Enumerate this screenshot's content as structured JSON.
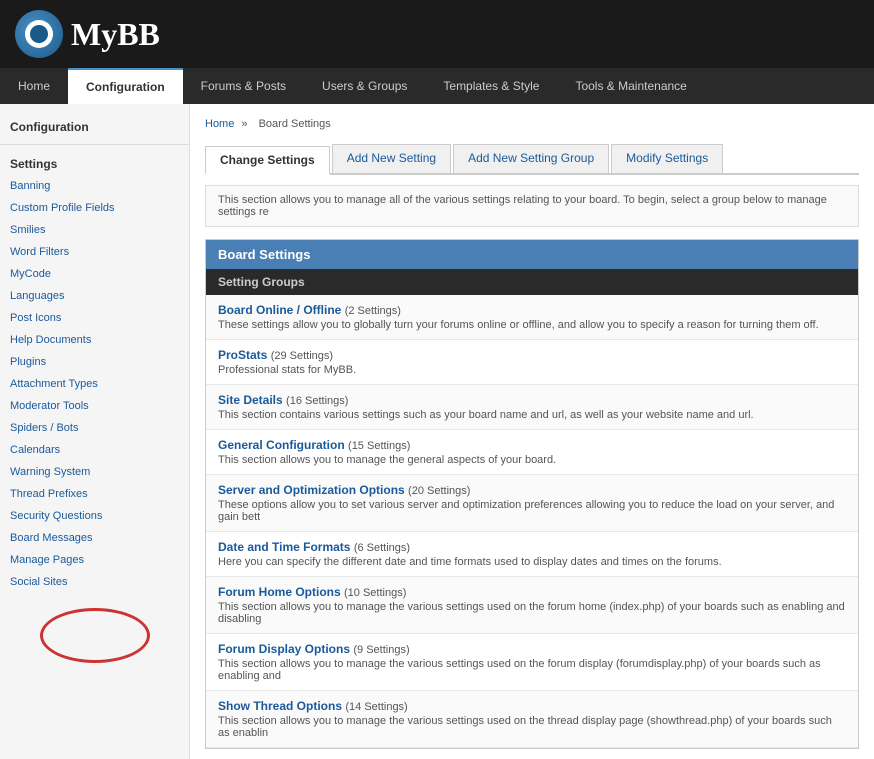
{
  "header": {
    "logo_text": "MyBB"
  },
  "nav": {
    "items": [
      {
        "id": "home",
        "label": "Home",
        "active": false
      },
      {
        "id": "configuration",
        "label": "Configuration",
        "active": true
      },
      {
        "id": "forums-posts",
        "label": "Forums & Posts",
        "active": false
      },
      {
        "id": "users-groups",
        "label": "Users & Groups",
        "active": false
      },
      {
        "id": "templates-style",
        "label": "Templates & Style",
        "active": false
      },
      {
        "id": "tools-maintenance",
        "label": "Tools & Maintenance",
        "active": false
      }
    ]
  },
  "breadcrumb": {
    "home": "Home",
    "separator": "»",
    "current": "Board Settings"
  },
  "sidebar": {
    "title": "Configuration",
    "heading": "Settings",
    "items": [
      {
        "id": "banning",
        "label": "Banning"
      },
      {
        "id": "custom-profile-fields",
        "label": "Custom Profile Fields"
      },
      {
        "id": "smilies",
        "label": "Smilies"
      },
      {
        "id": "word-filters",
        "label": "Word Filters"
      },
      {
        "id": "mycode",
        "label": "MyCode"
      },
      {
        "id": "languages",
        "label": "Languages"
      },
      {
        "id": "post-icons",
        "label": "Post Icons"
      },
      {
        "id": "help-documents",
        "label": "Help Documents"
      },
      {
        "id": "plugins",
        "label": "Plugins"
      },
      {
        "id": "attachment-types",
        "label": "Attachment Types"
      },
      {
        "id": "moderator-tools",
        "label": "Moderator Tools"
      },
      {
        "id": "spiders-bots",
        "label": "Spiders / Bots"
      },
      {
        "id": "calendars",
        "label": "Calendars"
      },
      {
        "id": "warning-system",
        "label": "Warning System"
      },
      {
        "id": "thread-prefixes",
        "label": "Thread Prefixes"
      },
      {
        "id": "security-questions",
        "label": "Security Questions"
      },
      {
        "id": "board-messages",
        "label": "Board Messages"
      },
      {
        "id": "manage-pages",
        "label": "Manage Pages"
      },
      {
        "id": "social-sites",
        "label": "Social Sites"
      }
    ]
  },
  "tabs": [
    {
      "id": "change-settings",
      "label": "Change Settings",
      "active": true
    },
    {
      "id": "add-new-setting",
      "label": "Add New Setting",
      "active": false
    },
    {
      "id": "add-new-setting-group",
      "label": "Add New Setting Group",
      "active": false
    },
    {
      "id": "modify-settings",
      "label": "Modify Settings",
      "active": false
    }
  ],
  "info_bar": {
    "text": "This section allows you to manage all of the various settings relating to your board. To begin, select a group below to manage settings re"
  },
  "board_settings": {
    "header": "Board Settings",
    "subheader": "Setting Groups",
    "groups": [
      {
        "id": "board-online-offline",
        "title": "Board Online / Offline",
        "count": "(2 Settings)",
        "description": "These settings allow you to globally turn your forums online or offline, and allow you to specify a reason for turning them off."
      },
      {
        "id": "prostats",
        "title": "ProStats",
        "count": "(29 Settings)",
        "description": "Professional stats for MyBB."
      },
      {
        "id": "site-details",
        "title": "Site Details",
        "count": "(16 Settings)",
        "description": "This section contains various settings such as your board name and url, as well as your website name and url."
      },
      {
        "id": "general-configuration",
        "title": "General Configuration",
        "count": "(15 Settings)",
        "description": "This section allows you to manage the general aspects of your board."
      },
      {
        "id": "server-optimization",
        "title": "Server and Optimization Options",
        "count": "(20 Settings)",
        "description": "These options allow you to set various server and optimization preferences allowing you to reduce the load on your server, and gain bett"
      },
      {
        "id": "date-time-formats",
        "title": "Date and Time Formats",
        "count": "(6 Settings)",
        "description": "Here you can specify the different date and time formats used to display dates and times on the forums."
      },
      {
        "id": "forum-home-options",
        "title": "Forum Home Options",
        "count": "(10 Settings)",
        "description": "This section allows you to manage the various settings used on the forum home (index.php) of your boards such as enabling and disabling"
      },
      {
        "id": "forum-display-options",
        "title": "Forum Display Options",
        "count": "(9 Settings)",
        "description": "This section allows you to manage the various settings used on the forum display (forumdisplay.php) of your boards such as enabling and"
      },
      {
        "id": "show-thread-options",
        "title": "Show Thread Options",
        "count": "(14 Settings)",
        "description": "This section allows you to manage the various settings used on the thread display page (showthread.php) of your boards such as enablin"
      }
    ]
  }
}
